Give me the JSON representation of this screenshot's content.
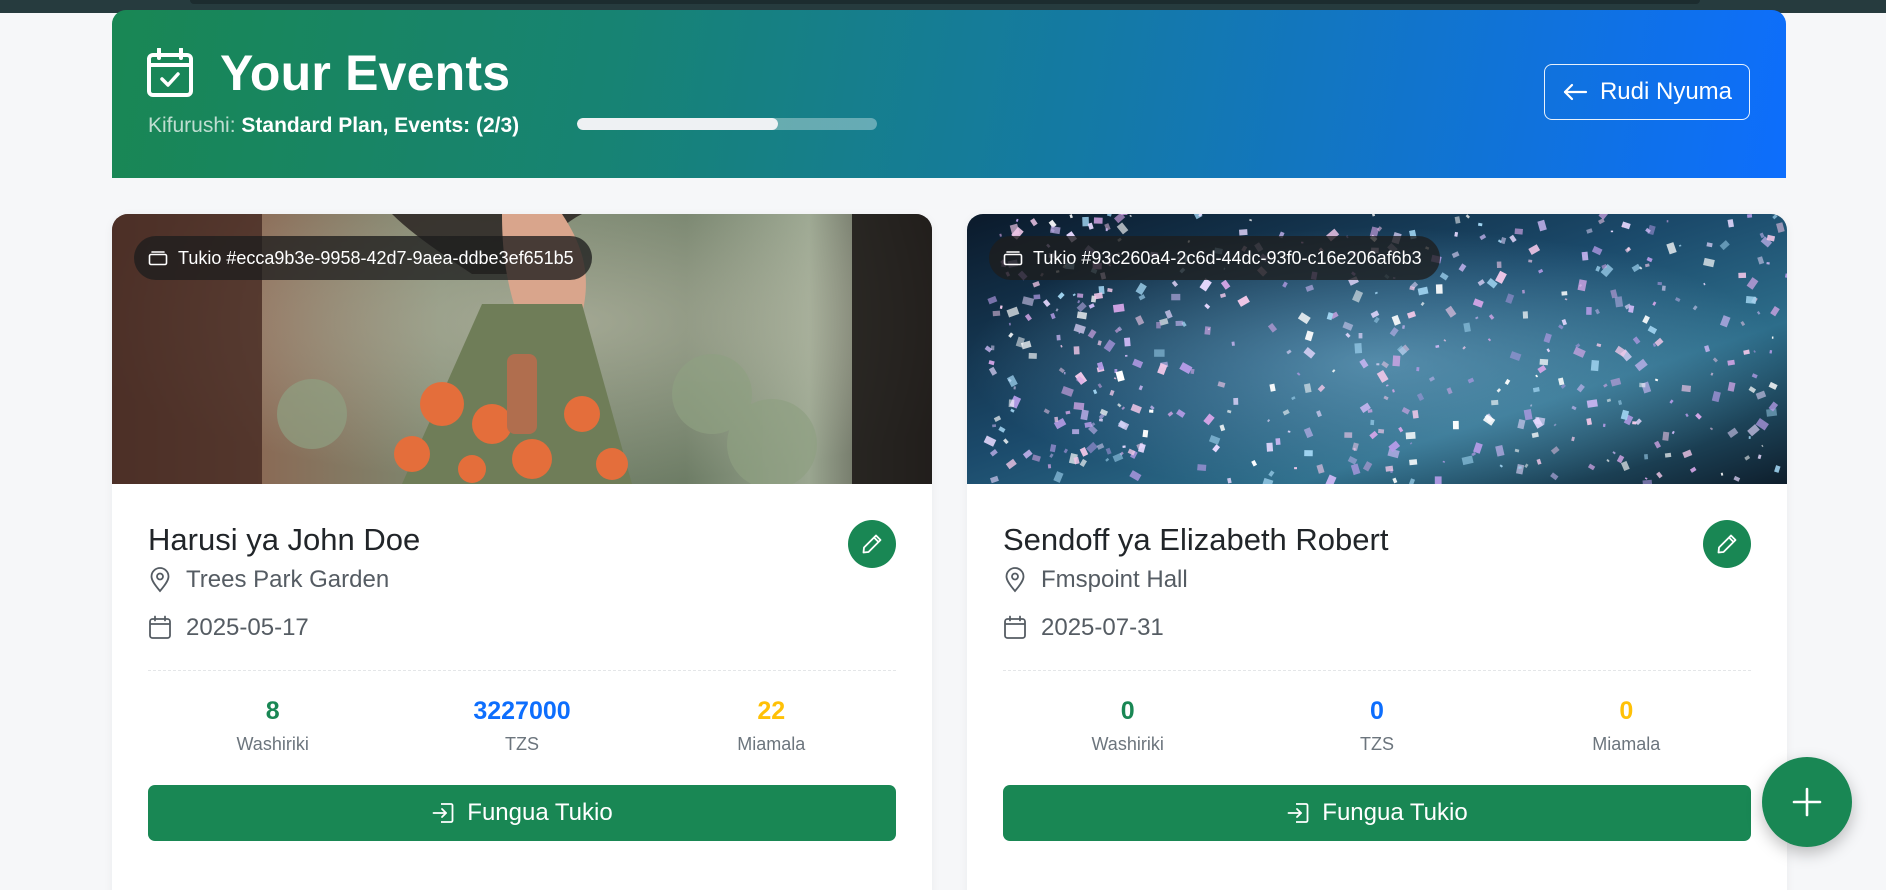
{
  "header": {
    "title": "Your Events",
    "plan_label": "Kifurushi:",
    "plan_value": "Standard Plan, Events: (2/3)",
    "plan_progress": 0.67,
    "back_label": "Rudi Nyuma"
  },
  "events": [
    {
      "id_label": "Tukio #ecca9b3e-9958-42d7-9aea-ddbe3ef651b5",
      "name": "Harusi ya John Doe",
      "location": "Trees Park Garden",
      "date": "2025-05-17",
      "stats": [
        {
          "value": "8",
          "label": "Washiriki"
        },
        {
          "value": "3227000",
          "label": "TZS"
        },
        {
          "value": "22",
          "label": "Miamala"
        }
      ],
      "open_label": "Fungua Tukio"
    },
    {
      "id_label": "Tukio #93c260a4-2c6d-44dc-93f0-c16e206af6b3",
      "name": "Sendoff ya Elizabeth Robert",
      "location": "Fmspoint Hall",
      "date": "2025-07-31",
      "stats": [
        {
          "value": "0",
          "label": "Washiriki"
        },
        {
          "value": "0",
          "label": "TZS"
        },
        {
          "value": "0",
          "label": "Miamala"
        }
      ],
      "open_label": "Fungua Tukio"
    }
  ],
  "colors": {
    "primary_green": "#198754",
    "primary_blue": "#0d6efd",
    "warning_yellow": "#ffc107"
  },
  "icons": [
    "calendar-check-icon",
    "arrow-left-icon",
    "ticket-icon",
    "pencil-icon",
    "geo-pin-icon",
    "calendar-icon",
    "box-arrow-in-icon",
    "plus-icon"
  ]
}
